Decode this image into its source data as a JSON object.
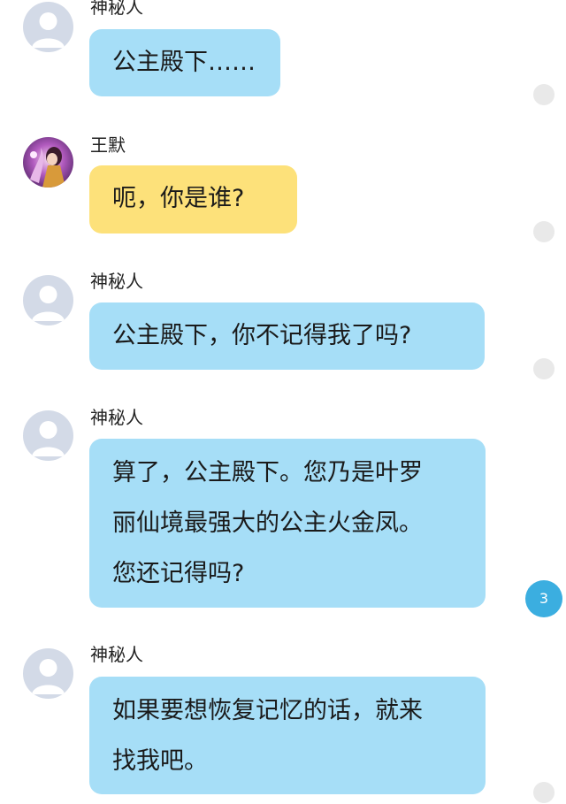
{
  "messages": [
    {
      "sender": "神秘人",
      "lines": [
        "公主殿下……"
      ],
      "style": "blue"
    },
    {
      "sender": "王默",
      "lines": [
        "呃，你是谁?"
      ],
      "style": "yellow"
    },
    {
      "sender": "神秘人",
      "lines": [
        "公主殿下，你不记得我了吗?"
      ],
      "style": "blue"
    },
    {
      "sender": "神秘人",
      "lines": [
        "算了，公主殿下。您乃是叶罗",
        "丽仙境最强大的公主火金凤。",
        "您还记得吗?"
      ],
      "style": "blue"
    },
    {
      "sender": "神秘人",
      "lines": [
        "如果要想恢复记忆的话，就来",
        "找我吧。"
      ],
      "style": "blue"
    }
  ],
  "unread_badge": "3",
  "colors": {
    "bubble_blue": "#a6def7",
    "bubble_yellow": "#fde17a",
    "badge": "#3baee0",
    "default_avatar": "#d3dae7"
  }
}
